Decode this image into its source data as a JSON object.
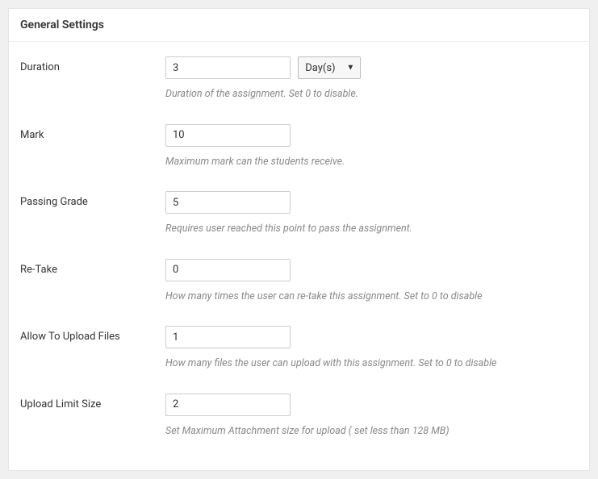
{
  "panel": {
    "title": "General Settings"
  },
  "fields": {
    "duration": {
      "label": "Duration",
      "value": "3",
      "unit_selected": "Day(s)",
      "description": "Duration of the assignment. Set 0 to disable."
    },
    "mark": {
      "label": "Mark",
      "value": "10",
      "description": "Maximum mark can the students receive."
    },
    "passing_grade": {
      "label": "Passing Grade",
      "value": "5",
      "description": "Requires user reached this point to pass the assignment."
    },
    "retake": {
      "label": "Re-Take",
      "value": "0",
      "description": "How many times the user can re-take this assignment. Set to 0 to disable"
    },
    "allow_upload": {
      "label": "Allow To Upload Files",
      "value": "1",
      "description": "How many files the user can upload with this assignment. Set to 0 to disable"
    },
    "upload_limit": {
      "label": "Upload Limit Size",
      "value": "2",
      "description": "Set Maximum Attachment size for upload ( set less than 128 MB)"
    }
  }
}
